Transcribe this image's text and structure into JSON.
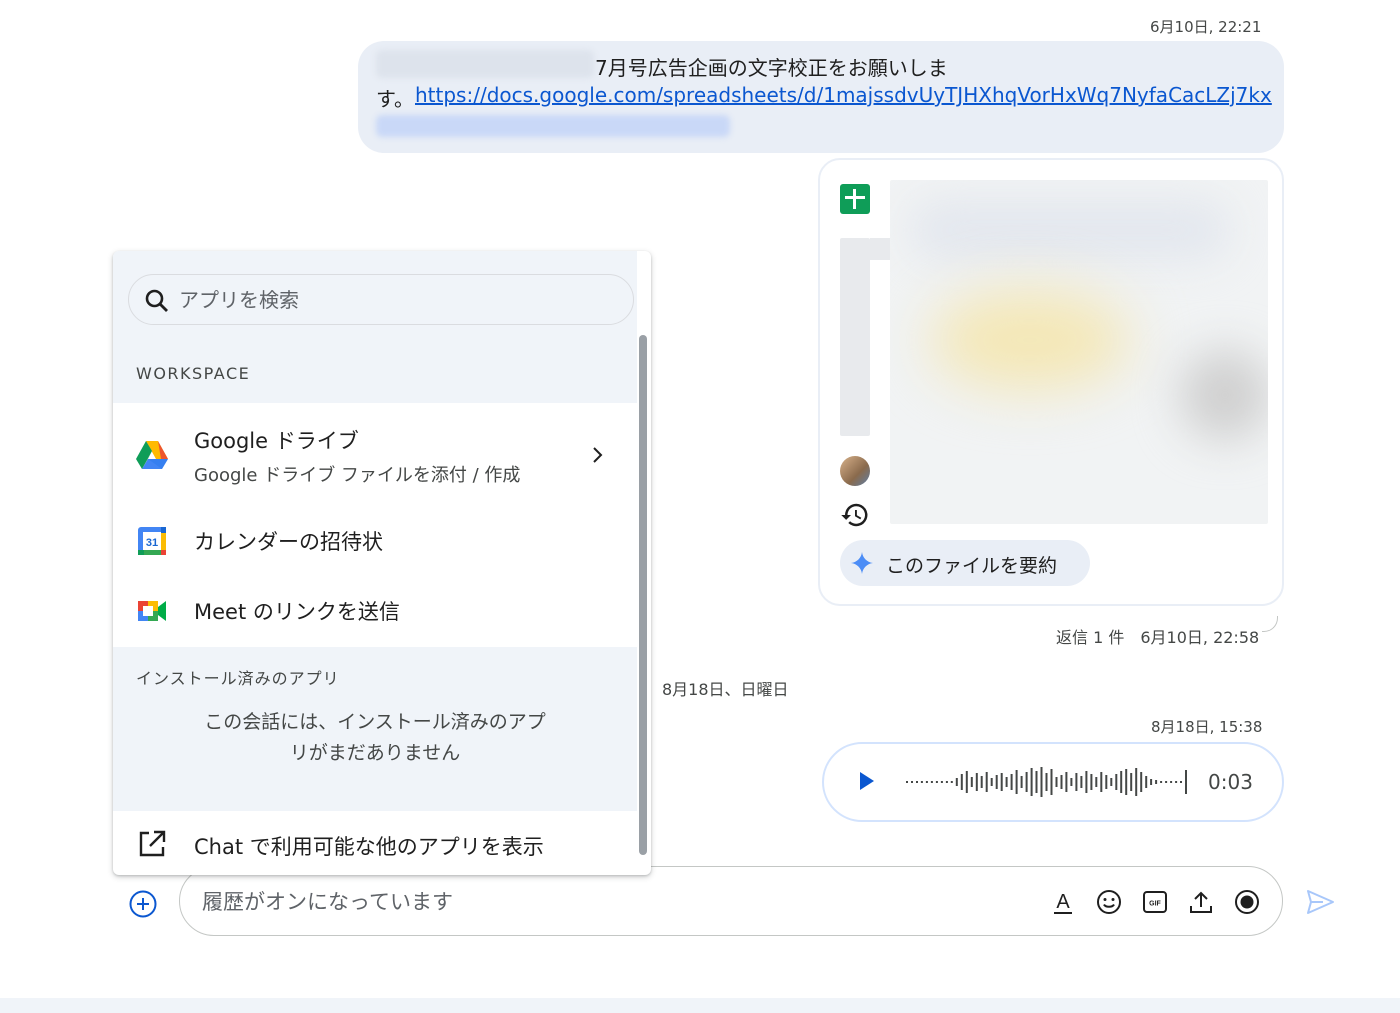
{
  "messages": {
    "first": {
      "timestamp": "6月10日, 22:21",
      "text_line1": "7月号広告企画の文字校正をお願いしま",
      "text_prefix": "す。",
      "link": "https://docs.google.com/spreadsheets/d/1majssdvUyTJHXhqVorHxWq7NyfaCacLZj7kx"
    },
    "file_card": {
      "summarize_label": "このファイルを要約",
      "reply_info": "返信 1 件　6月10日, 22:58"
    },
    "date_separator": "8月18日、日曜日",
    "voice": {
      "timestamp": "8月18日, 15:38",
      "duration": "0:03"
    }
  },
  "composer": {
    "placeholder": "履歴がオンになっています"
  },
  "app_menu": {
    "search_placeholder": "アプリを検索",
    "workspace_label": "WORKSPACE",
    "items": [
      {
        "title": "Google ドライブ",
        "subtitle": "Google ドライブ ファイルを添付 / 作成",
        "icon": "google-drive-icon"
      },
      {
        "title": "カレンダーの招待状",
        "icon": "google-calendar-icon"
      },
      {
        "title": "Meet のリンクを送信",
        "icon": "google-meet-icon"
      }
    ],
    "installed_label": "インストール済みのアプリ",
    "installed_empty_line1": "この会話には、インストール済みのアプ",
    "installed_empty_line2": "リがまだありません",
    "more_apps_label": "Chat で利用可能な他のアプリを表示"
  },
  "colors": {
    "accent": "#0b57d0",
    "bubble": "#e9eef6",
    "panel": "#f0f4f9"
  }
}
